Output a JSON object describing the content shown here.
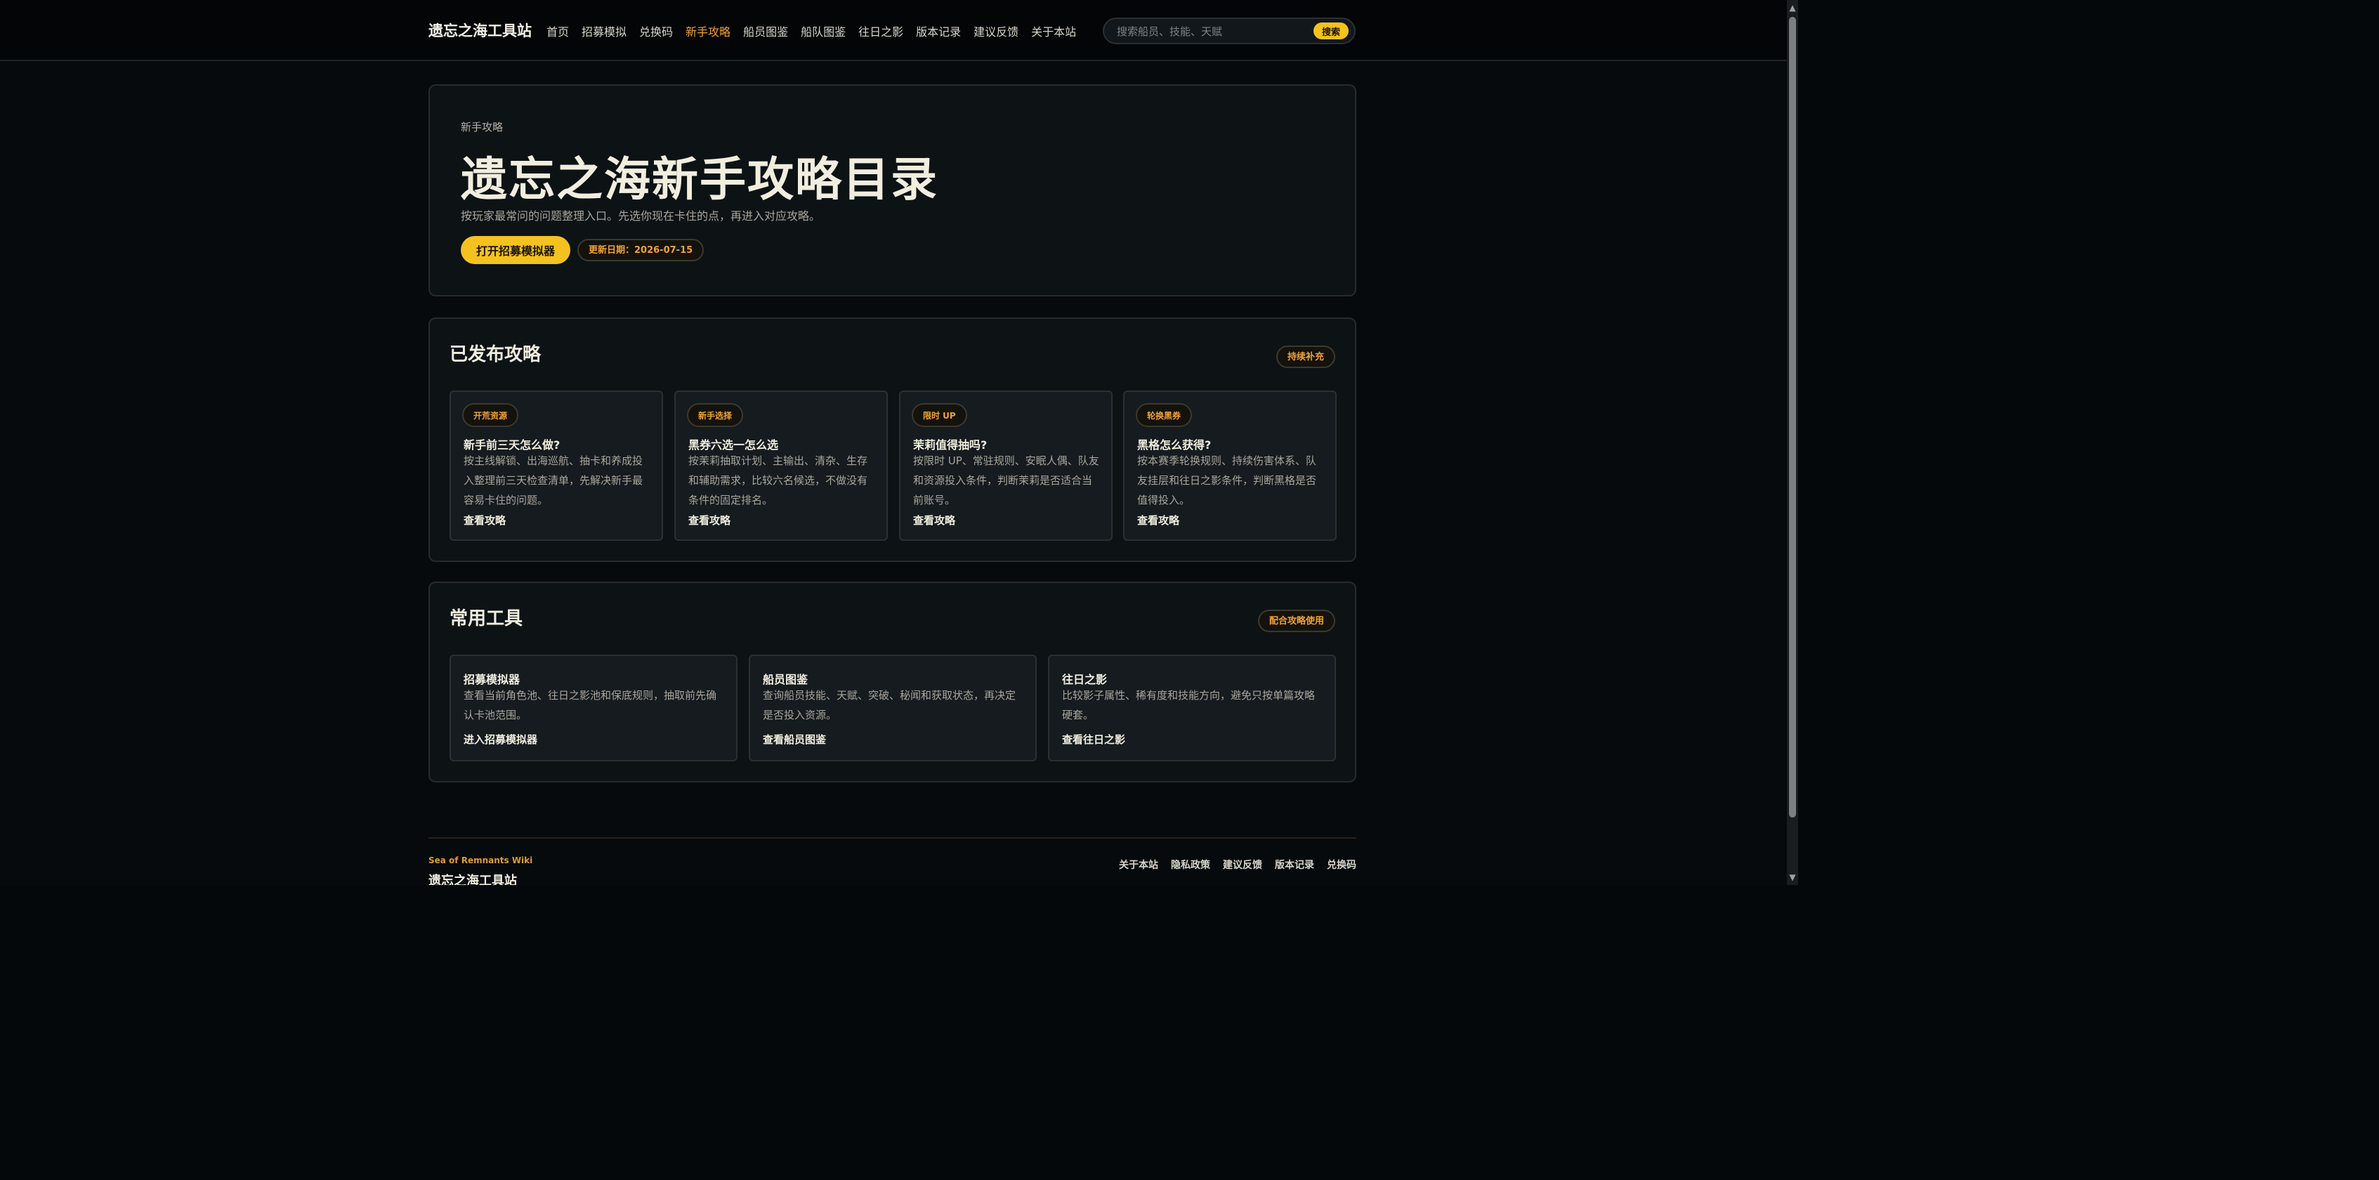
{
  "header": {
    "brand": "遗忘之海工具站",
    "nav": [
      "首页",
      "招募模拟",
      "兑换码",
      "新手攻略",
      "船员图鉴",
      "船队图鉴",
      "往日之影",
      "版本记录",
      "建议反馈",
      "关于本站"
    ],
    "active_nav": "新手攻略",
    "search": {
      "placeholder": "搜索船员、技能、天赋",
      "button_label": "搜索"
    }
  },
  "hero": {
    "eyebrow": "新手攻略",
    "title": "遗忘之海新手攻略目录",
    "lede": "按玩家最常问的问题整理入口。先选你现在卡住的点，再进入对应攻略。",
    "primary_button": "打开招募模拟器",
    "updated": "更新日期：2026-07-15"
  },
  "published": {
    "title": "已发布攻略",
    "badge": "持续补充",
    "cards": [
      {
        "tag": "开荒资源",
        "title": "新手前三天怎么做?",
        "desc": "按主线解锁、出海巡航、抽卡和养成投入整理前三天检查清单，先解决新手最容易卡住的问题。",
        "link": "查看攻略"
      },
      {
        "tag": "新手选择",
        "title": "黑券六选一怎么选",
        "desc": "按茉莉抽取计划、主输出、清杂、生存和辅助需求，比较六名候选，不做没有条件的固定排名。",
        "link": "查看攻略"
      },
      {
        "tag": "限时 UP",
        "title": "茉莉值得抽吗?",
        "desc": "按限时 UP、常驻规则、安眠人偶、队友和资源投入条件，判断茉莉是否适合当前账号。",
        "link": "查看攻略"
      },
      {
        "tag": "轮换黑券",
        "title": "黑格怎么获得?",
        "desc": "按本赛季轮换规则、持续伤害体系、队友挂层和往日之影条件，判断黑格是否值得投入。",
        "link": "查看攻略"
      }
    ]
  },
  "tools": {
    "title": "常用工具",
    "badge": "配合攻略使用",
    "cards": [
      {
        "title": "招募模拟器",
        "desc": "查看当前角色池、往日之影池和保底规则，抽取前先确认卡池范围。",
        "link": "进入招募模拟器"
      },
      {
        "title": "船员图鉴",
        "desc": "查询船员技能、天赋、突破、秘闻和获取状态，再决定是否投入资源。",
        "link": "查看船员图鉴"
      },
      {
        "title": "往日之影",
        "desc": "比较影子属性、稀有度和技能方向，避免只按单篇攻略硬套。",
        "link": "查看往日之影"
      }
    ]
  },
  "footer": {
    "brand_en": "Sea of Remnants Wiki",
    "brand": "遗忘之海工具站",
    "links": [
      "关于本站",
      "隐私政策",
      "建议反馈",
      "版本记录",
      "兑换码"
    ]
  },
  "colors": {
    "accent": "#f4c21e",
    "accent_text": "#f0a235",
    "background": "#070a0d",
    "panel": "#0d1215"
  }
}
